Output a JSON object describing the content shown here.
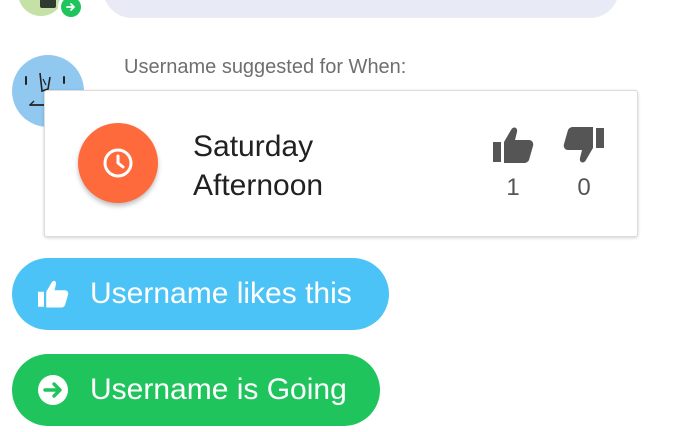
{
  "feed": {
    "suggestion": {
      "label": "Username suggested for When:",
      "option_title": "Saturday Afternoon",
      "upvotes": "1",
      "downvotes": "0"
    },
    "like_activity": {
      "label": "Username likes this"
    },
    "going_activity": {
      "label": "Username is Going"
    }
  },
  "colors": {
    "accent_orange": "#ff6a3d",
    "like_blue": "#4cc3f6",
    "going_green": "#1fc55c",
    "badge_indigo": "#3f51b5"
  },
  "icons": [
    "arrow-right-circle-icon",
    "star-icon",
    "clock-icon",
    "thumbs-up-icon",
    "thumbs-down-icon"
  ]
}
